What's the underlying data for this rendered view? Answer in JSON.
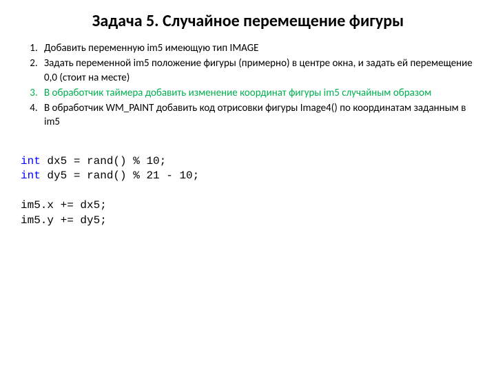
{
  "title": "Задача 5.  Случайное перемещение фигуры",
  "items": [
    "Добавить переменную im5 имеющую тип IMAGE",
    "Задать переменной im5 положение фигуры (примерно) в центре окна, и задать ей перемещение 0,0 (стоит на месте)",
    "В обработчик таймера добавить изменение координат фигуры  im5 случайным образом",
    "В обработчик WM_PAINT добавить код отрисовки фигуры Image4() по координатам заданным в im5"
  ],
  "code": {
    "kw": "int",
    "l1": " dx5 = rand() % 10;",
    "l2": " dy5 = rand() % 21 - 10;",
    "l3": "im5.x += dx5;",
    "l4": "im5.y += dy5;"
  }
}
